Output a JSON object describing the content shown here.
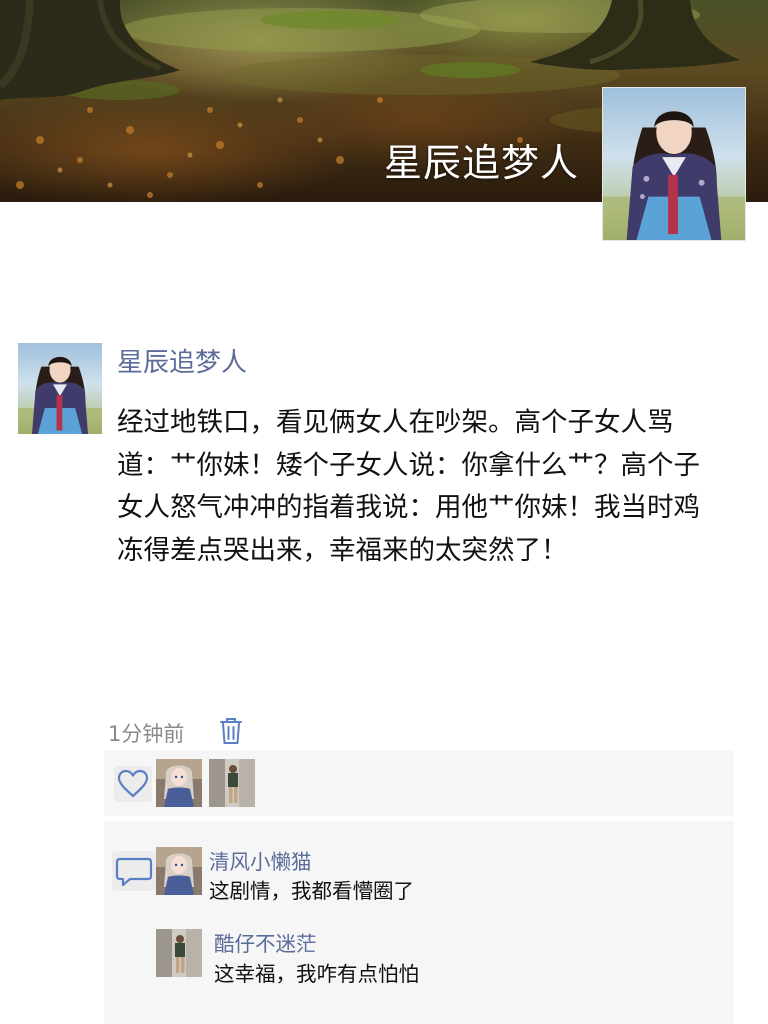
{
  "cover": {
    "title": "星辰追梦人"
  },
  "post": {
    "author": "星辰追梦人",
    "text": "经过地铁口，看见俩女人在吵架。高个子女人骂道：艹你妹！矮个子女人说：你拿什么艹？高个子女人怒气冲冲的指着我说：用他艹你妹！我当时鸡冻得差点哭出来，幸福来的太突然了！",
    "time": "1分钟前"
  },
  "likes": {
    "icon": "heart-icon",
    "users": [
      "anime-girl-avatar",
      "street-man-avatar"
    ]
  },
  "comments": [
    {
      "user": "清风小懒猫",
      "text": "这剧情，我都看懵圈了"
    },
    {
      "user": "酷仔不迷茫",
      "text": "这幸福，我咋有点怕怕"
    }
  ],
  "colors": {
    "link": "#5b6c9a",
    "panel": "#f6f6f6",
    "icon": "#5b7fc4"
  }
}
